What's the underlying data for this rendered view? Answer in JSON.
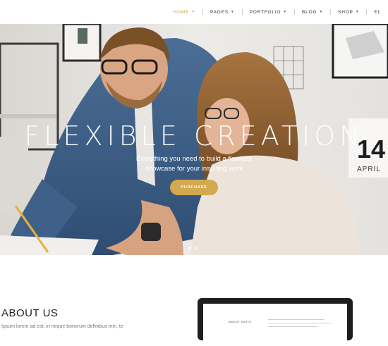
{
  "nav": {
    "items": [
      {
        "label": "HOME",
        "active": true
      },
      {
        "label": "PAGES",
        "active": false
      },
      {
        "label": "PORTFOLIO",
        "active": false
      },
      {
        "label": "BLOG",
        "active": false
      },
      {
        "label": "SHOP",
        "active": false
      },
      {
        "label": "EL",
        "active": false
      }
    ]
  },
  "hero": {
    "title": "FLEXIBLE CREATION",
    "subtitle_line1": "Everything you need to build a flawless",
    "subtitle_line2": "showcase for your inspiring work",
    "button_label": "PURCHASE",
    "calendar_day": "14",
    "calendar_month": "APRIL",
    "slides_total": 2,
    "slide_active": 1
  },
  "about": {
    "heading": "ABOUT US",
    "text": "Ipsum lorem ad est, in neque bonorum definibus mei, te",
    "laptop_label": "ABOUT RATIO"
  },
  "colors": {
    "accent": "#d3a84f",
    "text_dark": "#222222"
  }
}
